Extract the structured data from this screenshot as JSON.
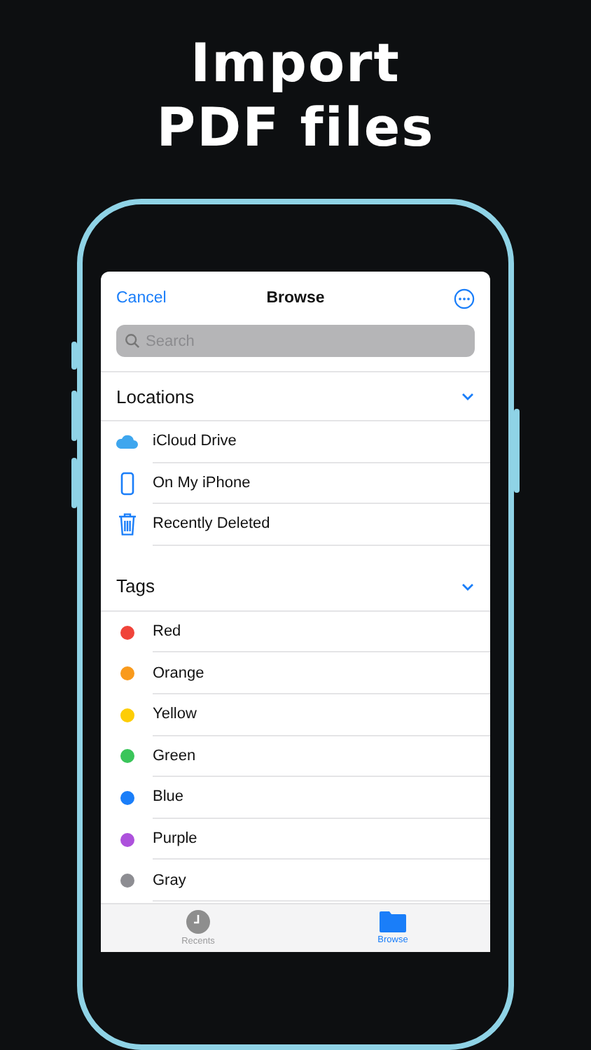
{
  "headline": [
    "Import",
    "PDF files"
  ],
  "nav": {
    "cancel": "Cancel",
    "title": "Browse"
  },
  "search": {
    "placeholder": "Search"
  },
  "sections": [
    {
      "title": "Locations",
      "expanded": true,
      "items": [
        {
          "label": "iCloud Drive",
          "kind": "cloud"
        },
        {
          "label": "On My iPhone",
          "kind": "phone"
        },
        {
          "label": "Recently Deleted",
          "kind": "trash"
        }
      ]
    },
    {
      "title": "Tags",
      "expanded": true,
      "items": [
        {
          "label": "Red",
          "color": "#f0443a"
        },
        {
          "label": "Orange",
          "color": "#f99a1c"
        },
        {
          "label": "Yellow",
          "color": "#fdcd05"
        },
        {
          "label": "Green",
          "color": "#3ac55a"
        },
        {
          "label": "Blue",
          "color": "#1a7ef9"
        },
        {
          "label": "Purple",
          "color": "#ad51dc"
        },
        {
          "label": "Gray",
          "color": "#8d8d92"
        }
      ]
    }
  ],
  "tabs": [
    {
      "label": "Recents",
      "kind": "clock",
      "selected": false
    },
    {
      "label": "Browse",
      "kind": "folder",
      "selected": true
    }
  ]
}
